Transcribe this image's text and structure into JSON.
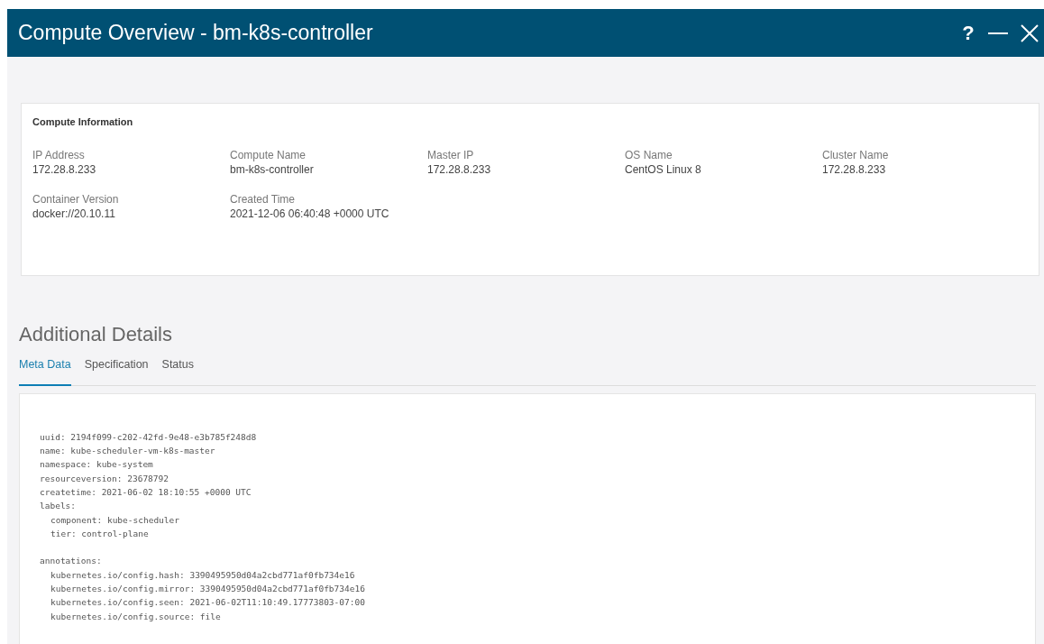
{
  "window": {
    "title": "Compute Overview - bm-k8s-controller",
    "controls": [
      {
        "kind": "help",
        "label": "?"
      },
      {
        "kind": "minimize"
      },
      {
        "kind": "close"
      }
    ]
  },
  "compute_information": {
    "title": "Compute Information",
    "fields": [
      {
        "label": "IP Address",
        "value": "172.28.8.233"
      },
      {
        "label": "Compute Name",
        "value": "bm-k8s-controller"
      },
      {
        "label": "Master IP",
        "value": "172.28.8.233"
      },
      {
        "label": "OS Name",
        "value": "CentOS Linux 8"
      },
      {
        "label": "Cluster Name",
        "value": "172.28.8.233"
      },
      {
        "label": "Container Version",
        "value": "docker://20.10.11"
      },
      {
        "label": "Created Time",
        "value": "2021-12-06 06:40:48 +0000 UTC"
      }
    ]
  },
  "additional_details": {
    "title": "Additional Details",
    "tabs": [
      {
        "label": "Meta Data",
        "selected": true
      },
      {
        "label": "Specification",
        "selected": false
      },
      {
        "label": "Status",
        "selected": false
      }
    ],
    "code_lines": [
      {
        "text": "uuid: 2194f099-c202-42fd-9e48-e3b785f248d8"
      },
      {
        "text": "name: kube-scheduler-vm-k8s-master"
      },
      {
        "text": "namespace: kube-system"
      },
      {
        "text": "resourceversion: 23678792"
      },
      {
        "text": "createtime: 2021-06-02 18:10:55 +0000 UTC"
      },
      {
        "text": "labels:",
        "children": [
          {
            "text": "component: kube-scheduler"
          },
          {
            "text": "tier: control-plane"
          }
        ]
      },
      {
        "text": "annotations:",
        "children": [
          {
            "text": "kubernetes.io/config.hash: 3390495950d04a2cbd771af0fb734e16"
          },
          {
            "text": "kubernetes.io/config.mirror: 3390495950d04a2cbd771af0fb734e16"
          },
          {
            "text": "kubernetes.io/config.seen: 2021-06-02T11:10:49.17773803-07:00"
          },
          {
            "text": "kubernetes.io/config.source: file"
          }
        ]
      }
    ]
  }
}
